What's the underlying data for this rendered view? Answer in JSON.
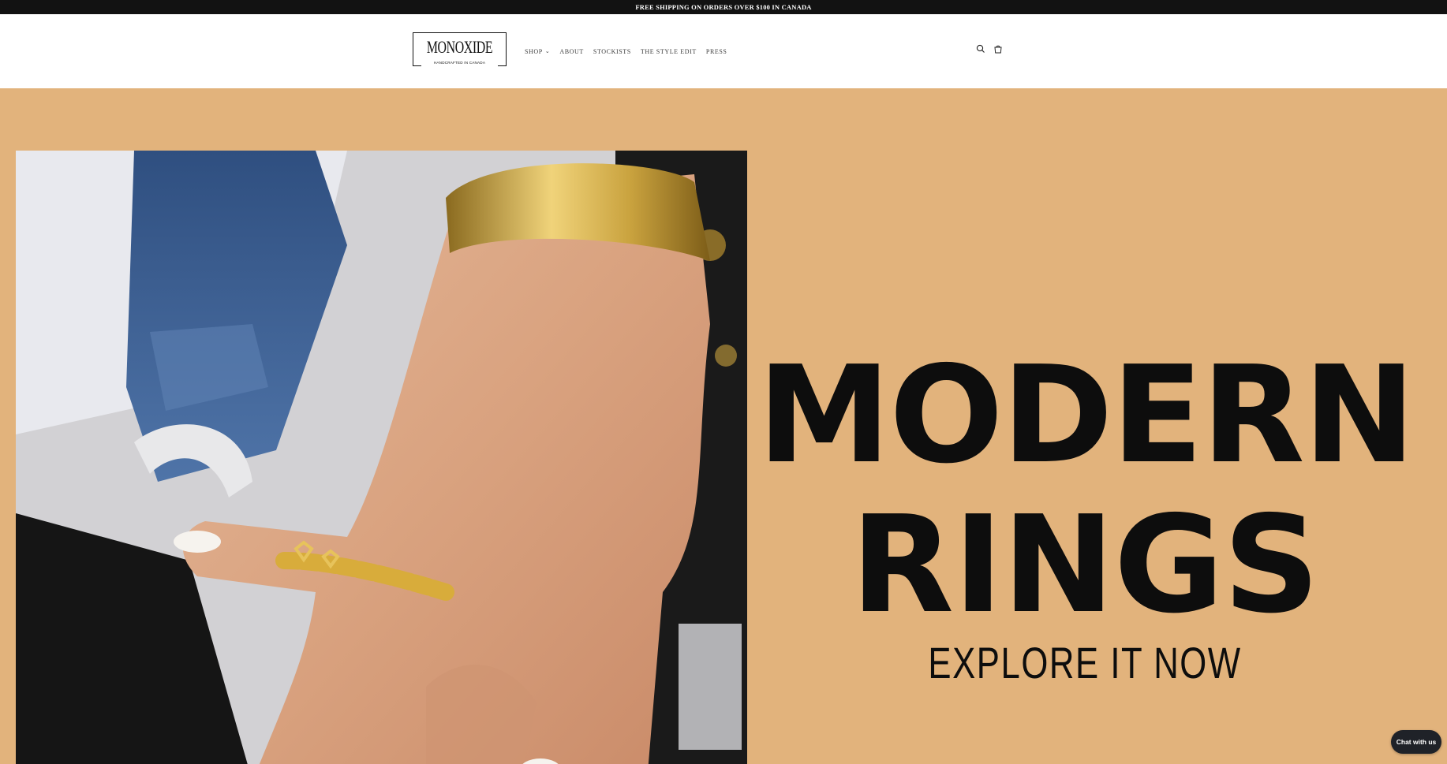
{
  "announcement": {
    "text": "FREE SHIPPING ON ORDERS OVER $100 IN CANADA"
  },
  "logo": {
    "wordmark": "MONOXIDE",
    "tagline": "HANDCRAFTED IN CANADA"
  },
  "nav": {
    "items": [
      {
        "label": "SHOP",
        "has_dropdown": true,
        "icon": "chevron-down-icon"
      },
      {
        "label": "ABOUT"
      },
      {
        "label": "STOCKISTS"
      },
      {
        "label": "THE STYLE EDIT"
      },
      {
        "label": "PRESS"
      }
    ]
  },
  "header_icons": {
    "search": "search-icon",
    "cart": "cart-icon"
  },
  "hero": {
    "heading_line1": "MODERN",
    "heading_line2": "RINGS",
    "cta": "EXPLORE IT NOW",
    "background_color": "#e2b37c",
    "image": "hand-with-gold-chain-ring-and-cuff"
  },
  "chat": {
    "label": "Chat with us"
  },
  "colors": {
    "announcement_bg": "#121212",
    "hero_bg": "#e2b37c",
    "text": "#0d0d0d",
    "chat_bg": "#1f2228"
  }
}
